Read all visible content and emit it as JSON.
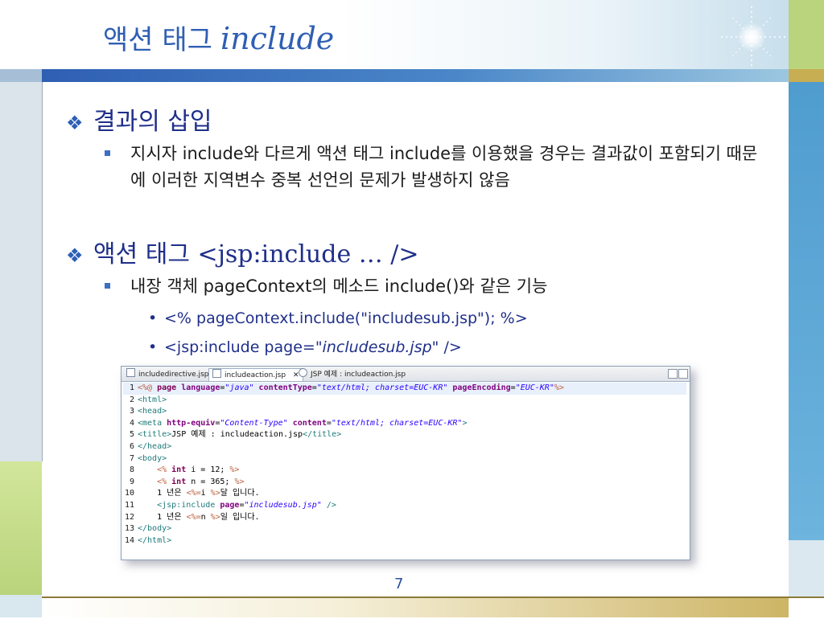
{
  "slide": {
    "title_korean": "액션 태그",
    "title_latin": "include",
    "page_number": "7"
  },
  "bullets": {
    "b1": "결과의 삽입",
    "b1_sub": "지시자 include와 다르게 액션 태그 include를 이용했을 경우는 결과값이 포함되기 때문에 이러한 지역변수 중복 선언의 문제가 발생하지 않음",
    "b2": "액션 태그 <jsp:include … />",
    "b2_sub": "내장 객체 pageContext의 메소드 include()와 같은 기능",
    "b2_items": [
      "<% pageContext.include(\"includesub.jsp\"); %>",
      "<jsp:include page=",
      "\"includesub.jsp\"",
      " />"
    ]
  },
  "editor": {
    "tabs": [
      "includedirective.jsp",
      "includeaction.jsp",
      "JSP 예제 : includeaction.jsp"
    ],
    "tab_close": "✕"
  },
  "code_text": {
    "l1_open": "<%@ ",
    "l1_page": "page ",
    "l1_a1": "language",
    "l1_v1": "\"java\"",
    "l1_a2": " contentType",
    "l1_v2": "\"text/html; charset=EUC-KR\"",
    "l1_a3": " pageEncoding",
    "l1_v3": "\"EUC-KR\"",
    "l1_close": "%>",
    "l2": "<html>",
    "l3": "<head>",
    "l4_tag": "<meta ",
    "l4_a1": "http-equiv",
    "l4_v1": "\"Content-Type\"",
    "l4_a2": " content",
    "l4_v2": "\"text/html; charset=EUC-KR\"",
    "l4_end": ">",
    "l5_t1": "<title>",
    "l5_text": "JSP 예제 : includeaction.jsp",
    "l5_t2": "</title>",
    "l6": "</head>",
    "l7": "<body>",
    "l8_open": "<% ",
    "l8_kw": "int",
    "l8_text": " i = 12; ",
    "l8_close": "%>",
    "l9_open": "<% ",
    "l9_kw": "int",
    "l9_text": " n = 365; ",
    "l9_close": "%>",
    "l10_a": "1 년은 ",
    "l10_open": "<%=",
    "l10_b": "i ",
    "l10_close": "%>",
    "l10_c": "달 입니다.",
    "l11_tag": "<jsp:include ",
    "l11_attr": "page",
    "l11_val": "\"includesub.jsp\"",
    "l11_end": " />",
    "l12_a": "1 년은 ",
    "l12_open": "<%=",
    "l12_b": "n ",
    "l12_close": "%>",
    "l12_c": "일 입니다.",
    "l13": "</body>",
    "l14": "</html>",
    "eq": "="
  },
  "colors": {
    "title": "#2f5fb3",
    "bullet_heading": "#1f2f8a",
    "accent_blue": "#3d6fc4",
    "frame_green": "#b9d47c",
    "frame_blue": "#5ba6d3",
    "frame_gold": "#c8ae52"
  }
}
